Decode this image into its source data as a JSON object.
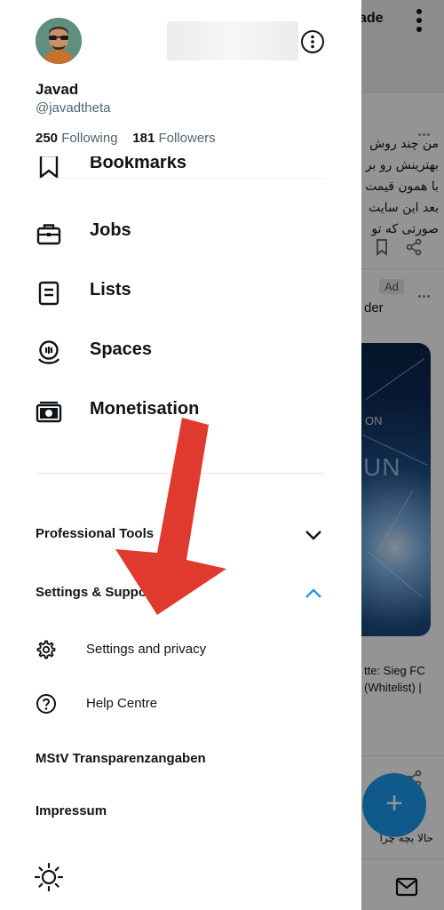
{
  "profile": {
    "display_name": "Javad",
    "handle": "@javadtheta",
    "following_count": "250",
    "following_label": "Following",
    "followers_count": "181",
    "followers_label": "Followers"
  },
  "menu": {
    "items": [
      {
        "label": "Bookmarks",
        "icon": "bookmark-icon"
      },
      {
        "label": "Jobs",
        "icon": "briefcase-icon"
      },
      {
        "label": "Lists",
        "icon": "list-icon"
      },
      {
        "label": "Spaces",
        "icon": "spaces-mic-icon"
      },
      {
        "label": "Monetisation",
        "icon": "money-icon"
      }
    ]
  },
  "sections": {
    "professional_tools": {
      "label": "Professional Tools",
      "expanded": false
    },
    "settings_support": {
      "label": "Settings & Support",
      "expanded": true
    }
  },
  "settings_items": [
    {
      "label": "Settings and privacy",
      "icon": "gear-icon"
    },
    {
      "label": "Help Centre",
      "icon": "help-icon"
    }
  ],
  "extra_links": {
    "mstv": "MStV Transparenzangaben",
    "impressum": "Impressum"
  },
  "theme_button_icon": "sun-icon",
  "background_feed": {
    "topbar_title": "ade",
    "tweet_lines": [
      "من چند روش",
      "بهترینش رو بر",
      "با همون قیمت",
      "بعد این سایت",
      "صورتی که تو"
    ],
    "ad_badge": "Ad",
    "ad_account": "der",
    "ad_image_text_small": "ON",
    "ad_image_text_large": "UN",
    "ad_caption_lines": [
      "tte: Sieg FC",
      "(Whitelist) |"
    ],
    "bottom_tweet_text": "حالا بچه چرا",
    "fab_icon": "plus-icon",
    "nav_icon": "mail-icon"
  },
  "colors": {
    "accent": "#1d9bf0",
    "arrow": "#e03a2f",
    "secondary_text": "#536471"
  }
}
